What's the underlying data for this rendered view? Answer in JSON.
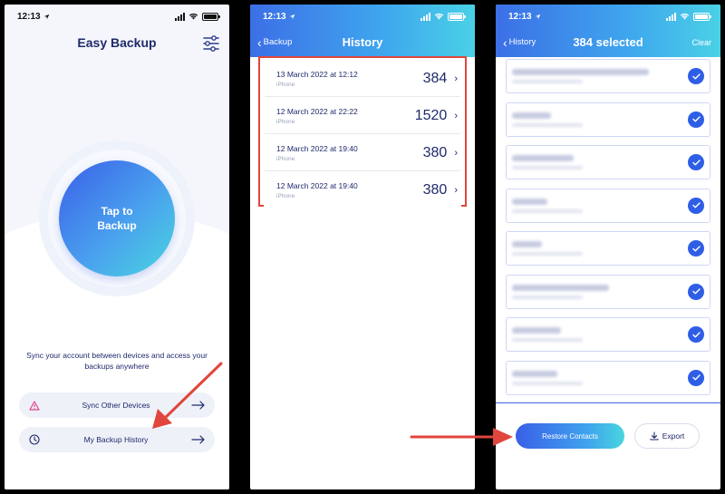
{
  "status": {
    "time": "12:13"
  },
  "screen1": {
    "title": "Easy Backup",
    "tap_label": "Tap to Backup",
    "sync_text": "Sync your account between devices and access your backups anywhere",
    "actions": [
      {
        "label": "Sync Other Devices",
        "icon": "warning-triangle-icon"
      },
      {
        "label": "My Backup History",
        "icon": "clock-icon"
      }
    ]
  },
  "screen2": {
    "back_label": "Backup",
    "title": "History",
    "rows": [
      {
        "date": "13 March 2022 at 12:12",
        "device": "iPhone",
        "count": "384"
      },
      {
        "date": "12 March 2022 at 22:22",
        "device": "iPhone",
        "count": "1520"
      },
      {
        "date": "12 March 2022 at 19:40",
        "device": "iPhone",
        "count": "380"
      },
      {
        "date": "12 March 2022 at 19:40",
        "device": "iPhone",
        "count": "380"
      }
    ]
  },
  "screen3": {
    "back_label": "History",
    "title": "384 selected",
    "clear_label": "Clear",
    "restore_label": "Restore Contacts",
    "export_label": "Export"
  },
  "colors": {
    "accent_blue": "#3a5fe8",
    "accent_cyan": "#48d6df",
    "annotation_red": "#e0463d",
    "text_navy": "#1f2a6b"
  }
}
